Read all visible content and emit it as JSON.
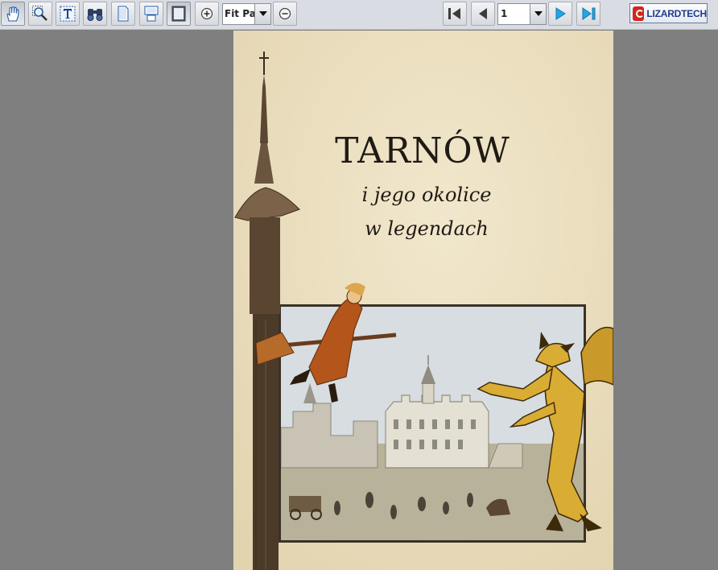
{
  "toolbar": {
    "tools": [
      {
        "name": "hand-tool",
        "icon": "hand-icon"
      },
      {
        "name": "zoom-tool",
        "icon": "magnifier-icon"
      },
      {
        "name": "text-select-tool",
        "icon": "text-select-icon"
      },
      {
        "name": "find-tool",
        "icon": "binoculars-icon"
      },
      {
        "name": "single-page-view",
        "icon": "single-page-icon"
      },
      {
        "name": "continuous-view",
        "icon": "continuous-page-icon"
      },
      {
        "name": "facing-pages-view",
        "icon": "facing-page-icon"
      }
    ],
    "zoom_value": "Fit Page",
    "page_value": "1",
    "logo_text": "LIZARDTECH"
  },
  "document": {
    "title": "TARNÓW",
    "subtitle_line1": "i jego okolice",
    "subtitle_line2": "w legendach"
  },
  "colors": {
    "toolbar_bg": "#d9dde3",
    "viewer_bg": "#7f7f7f",
    "page_bg": "#ece0c2",
    "nav_arrow": "#1fa7e8",
    "logo_text": "#1d3c8f"
  }
}
